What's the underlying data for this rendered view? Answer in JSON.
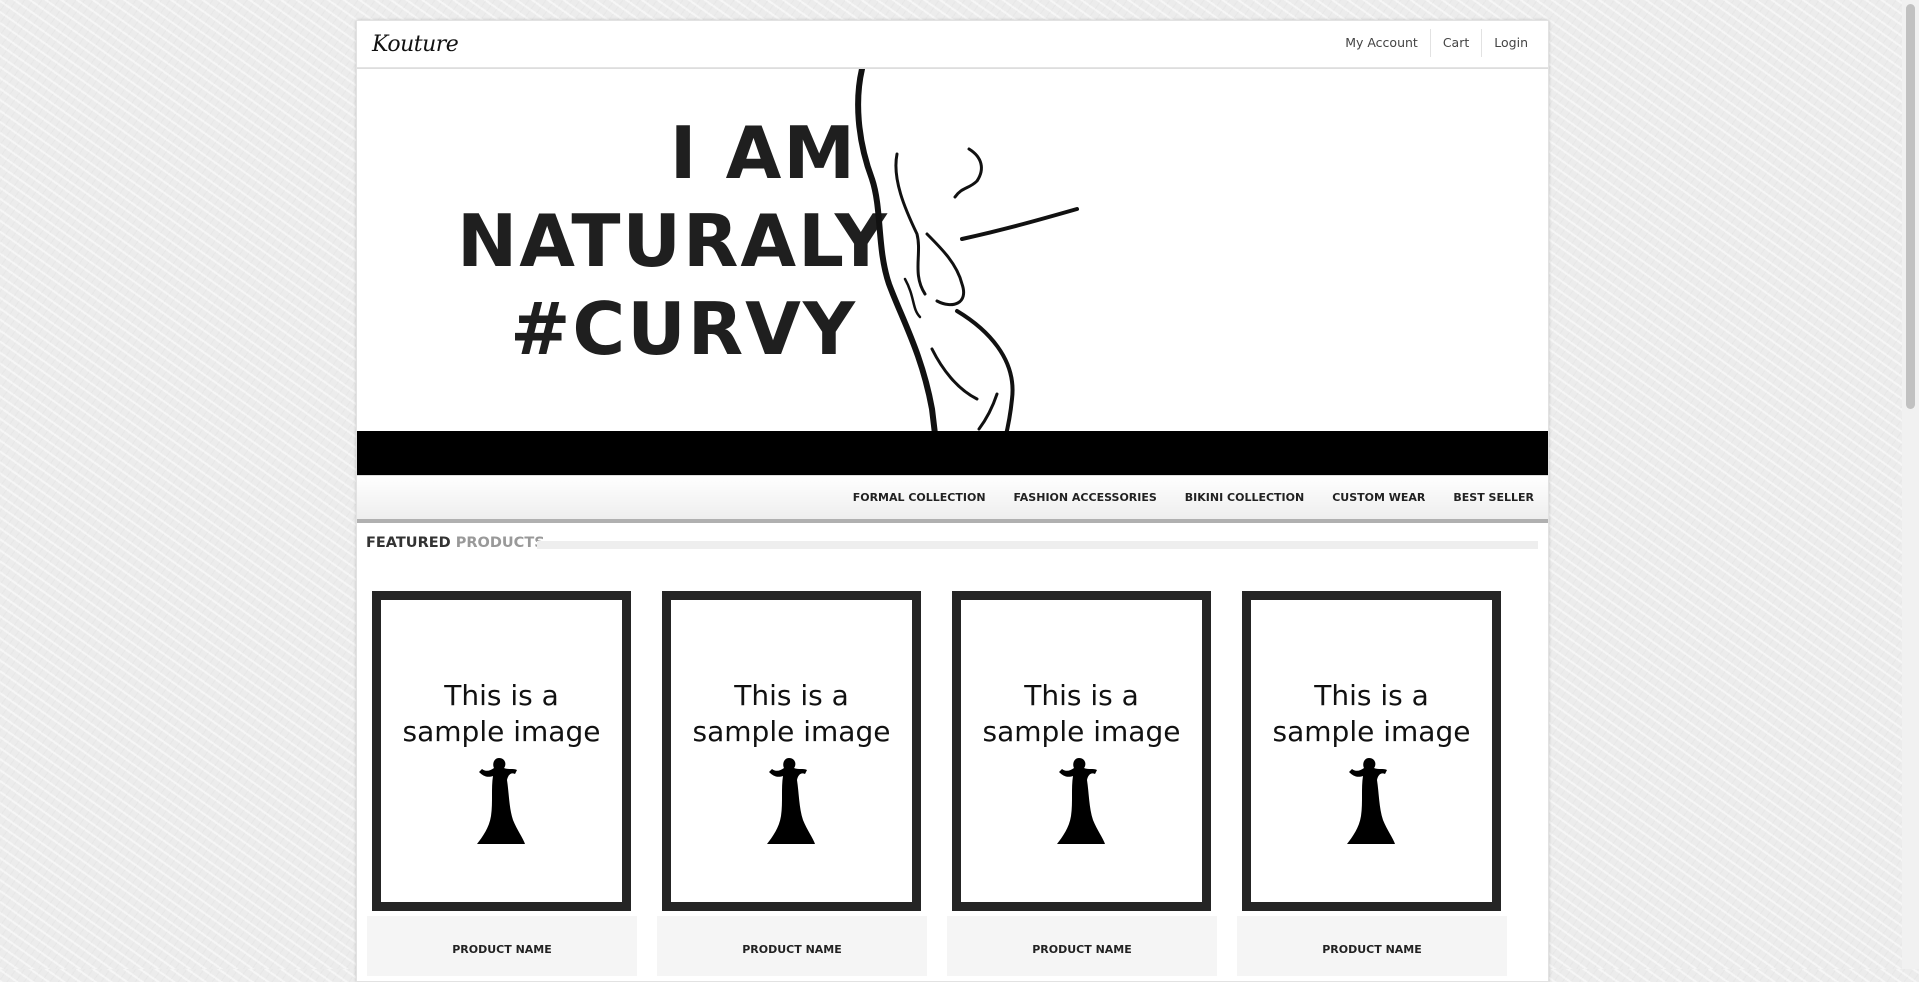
{
  "site": {
    "logo": "Kouture"
  },
  "topnav": [
    "My Account",
    "Cart",
    "Login"
  ],
  "hero": {
    "lines": [
      "I AM",
      "NATURALY",
      "#CURVY"
    ]
  },
  "mainnav": [
    "FORMAL COLLECTION",
    "FASHION ACCESSORIES",
    "BIKINI COLLECTION",
    "CUSTOM WEAR",
    "BEST SELLER"
  ],
  "featured": {
    "part1": "FEATURED",
    "part2": "PRODUCTS"
  },
  "products": [
    {
      "image_text": "This is a sample image",
      "name": "PRODUCT NAME"
    },
    {
      "image_text": "This is a sample image",
      "name": "PRODUCT NAME"
    },
    {
      "image_text": "This is a sample image",
      "name": "PRODUCT NAME"
    },
    {
      "image_text": "This is a sample image",
      "name": "PRODUCT NAME"
    }
  ]
}
